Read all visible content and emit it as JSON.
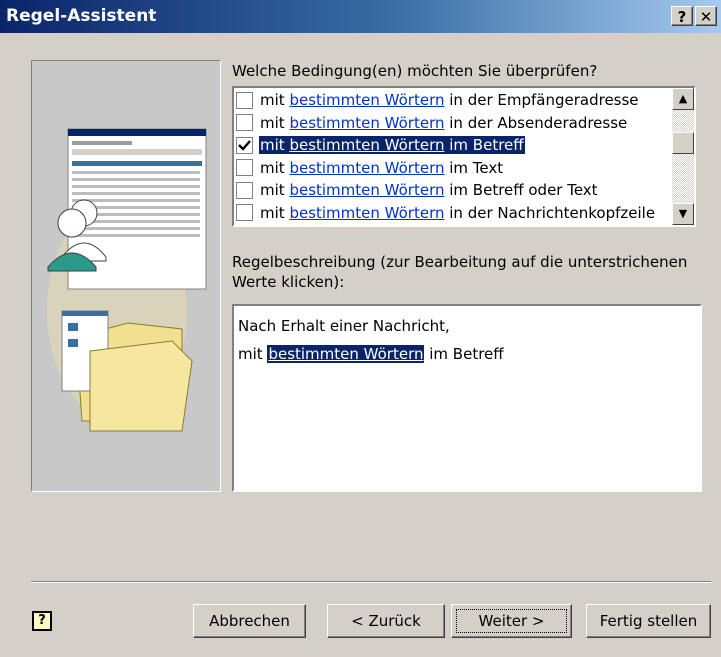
{
  "window": {
    "title": "Regel-Assistent",
    "help_button": "?",
    "close_button": "✕"
  },
  "conditions": {
    "label": "Welche Bedingung(en) möchten Sie überprüfen?",
    "items": [
      {
        "pre": "mit ",
        "link": "bestimmten Wörtern",
        "post": " in der Empfängeradresse",
        "checked": false,
        "selected": false
      },
      {
        "pre": "mit ",
        "link": "bestimmten Wörtern",
        "post": " in der Absenderadresse",
        "checked": false,
        "selected": false
      },
      {
        "pre": "mit ",
        "link": "bestimmten Wörtern",
        "post": " im Betreff",
        "checked": true,
        "selected": true
      },
      {
        "pre": "mit ",
        "link": "bestimmten Wörtern",
        "post": " im Text",
        "checked": false,
        "selected": false
      },
      {
        "pre": "mit ",
        "link": "bestimmten Wörtern",
        "post": " im Betreff oder Text",
        "checked": false,
        "selected": false
      },
      {
        "pre": "mit ",
        "link": "bestimmten Wörtern",
        "post": " in der Nachrichtenkopfzeile",
        "checked": false,
        "selected": false
      }
    ]
  },
  "description": {
    "label": "Regelbeschreibung (zur Bearbeitung auf die unterstrichenen Werte klicken):",
    "line1": "Nach Erhalt einer Nachricht,",
    "line2_pre": "mit ",
    "line2_link": "bestimmten Wörtern",
    "line2_post": " im Betreff"
  },
  "buttons": {
    "help": "?",
    "cancel": "Abbrechen",
    "back": "< Zurück",
    "next": "Weiter >",
    "finish": "Fertig stellen"
  },
  "colors": {
    "title_bar": "#0a246a",
    "selection": "#0a246a",
    "link": "#0033cc",
    "dialog_bg": "#d4d0c8"
  }
}
